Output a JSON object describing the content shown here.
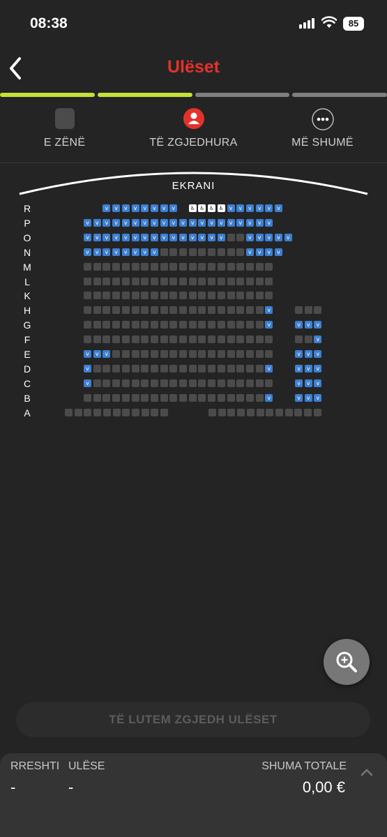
{
  "status": {
    "time": "08:38",
    "battery": "85"
  },
  "header": {
    "title": "Ulëset"
  },
  "progress": {
    "colors": [
      "#c6e03a",
      "#c6e03a",
      "#7f7f7f",
      "#7f7f7f"
    ]
  },
  "legend": {
    "taken": "E ZËNË",
    "selected": "TË ZGJEDHURA",
    "more": "MË SHUMË"
  },
  "screen_label": "EKRANI",
  "rows": [
    {
      "label": "R",
      "left": "  AAAAAAAA WWWWAAAAAA"
    },
    {
      "label": "P",
      "left": "AAAAAAAAAAAAAAAAAAAA"
    },
    {
      "label": "O",
      "left": "AAAAAAAAAAAAAAATTAAAAA"
    },
    {
      "label": "N",
      "left": "AAAAAAAATTTTTTTTTAAAA"
    },
    {
      "label": "M",
      "left": "TTTTTTTTTTTTTTTTTTTT"
    },
    {
      "label": "L",
      "left": "TTTTTTTTTTTTTTTTTTTT"
    },
    {
      "label": "K",
      "left": "TTTTTTTTTTTTTTTTTTTT"
    },
    {
      "label": "H",
      "left": "TTTTTTTTTTTTTTTTTTTA",
      "right": "TTT"
    },
    {
      "label": "G",
      "left": "TTTTTTTTTTTTTTTTTTTA",
      "right": "AAA"
    },
    {
      "label": "F",
      "left": "TTTTTTTTTTTTTTTTTTTT",
      "right": "TTA"
    },
    {
      "label": "E",
      "left": "AAATTTTTTTTTTTTTTTTT",
      "right": "AAA"
    },
    {
      "label": "D",
      "left": "ATTTTTTTTTTTTTTTTTTA",
      "right": "AAA"
    },
    {
      "label": "C",
      "left": "ATTTTTTTTTTTTTTTTTTT",
      "right": "AAA"
    },
    {
      "label": "B",
      "left": "TTTTTTTTTTTTTTTTTTTA",
      "right": "AAA"
    },
    {
      "label": "A",
      "special": "A"
    }
  ],
  "seat_symbols": {
    "available": "v",
    "wheelchair": "♿"
  },
  "cta": "TË LUTEM ZGJEDH ULËSET",
  "summary": {
    "row_label": "RRESHTI",
    "row_value": "-",
    "seat_label": "ULËSE",
    "seat_value": "-",
    "total_label": "SHUMA TOTALE",
    "total_value": "0,00 €"
  },
  "colors": {
    "brand": "#e4322b",
    "available": "#3d7fd0",
    "taken": "#4b4b4b"
  }
}
